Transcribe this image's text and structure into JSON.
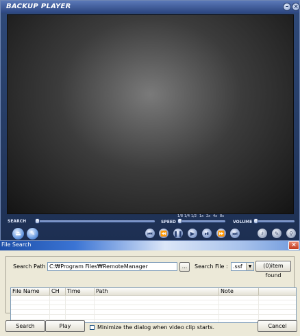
{
  "player": {
    "title": "BACKUP PLAYER",
    "minimize_icon": "minimize-icon",
    "close_icon": "close-icon",
    "search_label": "SEARCH",
    "speed_label": "SPEED",
    "speed_ticks": [
      "1/8",
      "1/4",
      "1/2",
      "1x",
      "2x",
      "4x",
      "8x"
    ],
    "volume_label": "VOLUME",
    "left_buttons": [
      "eject-icon",
      "settings-icon"
    ],
    "transport_buttons": [
      "skip-start-icon",
      "rewind-icon",
      "pause-icon",
      "play-icon",
      "step-forward-icon",
      "fast-forward-icon",
      "skip-end-icon"
    ],
    "right_buttons": [
      "mute-icon",
      "edit-icon",
      "zoom-icon"
    ],
    "accent": "#2c4680"
  },
  "dialog": {
    "title": "File Search",
    "search_path_label": "Search Path :",
    "search_path_value": "C:₩Program Files₩RemoteManager",
    "browse_label": "...",
    "search_file_label": "Search File :",
    "search_file_value": ".ssf",
    "item_count": "(0)item found",
    "columns": [
      "File Name",
      "CH",
      "Time",
      "Path",
      "Note",
      ""
    ],
    "search_button": "Search",
    "play_button": "Play",
    "minimize_checkbox_label": "Minimize the dialog when video clip starts.",
    "minimize_checked": false,
    "cancel_button": "Cancel"
  }
}
